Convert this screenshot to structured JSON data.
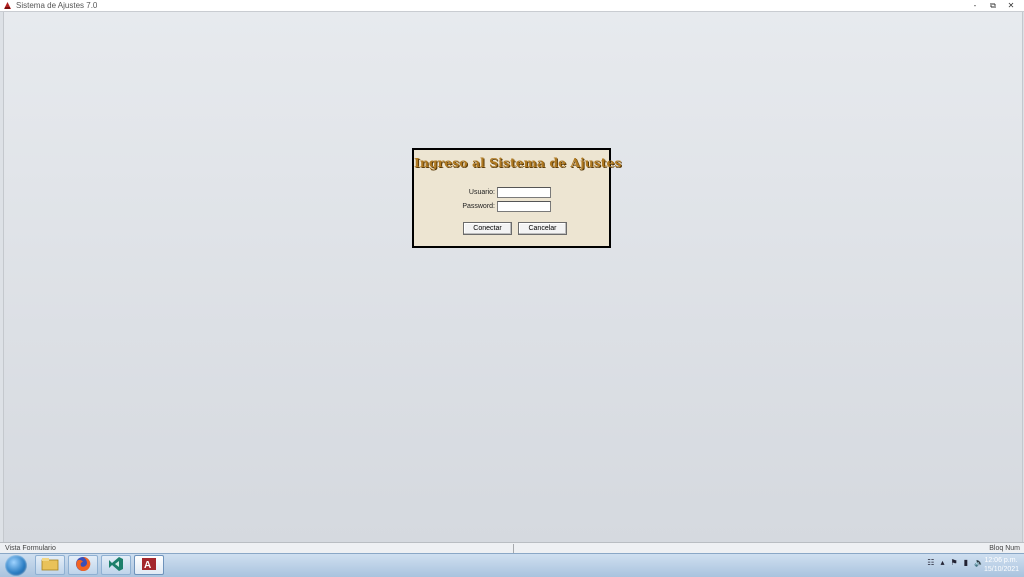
{
  "window": {
    "title": "Sistema de Ajustes 7.0",
    "controls": {
      "minimize": "-",
      "restore": "⧉",
      "close": "✕"
    }
  },
  "login": {
    "title": "Ingreso al Sistema de Ajustes",
    "usuario_label": "Usuario:",
    "usuario_value": "",
    "password_label": "Password:",
    "password_value": "",
    "connect_label": "Conectar",
    "cancel_label": "Cancelar"
  },
  "statusbar": {
    "left": "Vista Formulario",
    "right": "Bloq Num"
  },
  "taskbar": {
    "apps": [
      "file-explorer-icon",
      "firefox-icon",
      "visual-studio-icon",
      "access-icon"
    ],
    "tray_icons": [
      "network-icon",
      "arrow-up-icon",
      "flag-icon",
      "battery-icon",
      "speaker-icon"
    ],
    "clock_time": "12:06 p.m.",
    "clock_date": "15/10/2021"
  },
  "colors": {
    "dialog_bg": "#ede5d2",
    "title_gold": "#b07a22",
    "taskbar": "#a9c3de"
  }
}
